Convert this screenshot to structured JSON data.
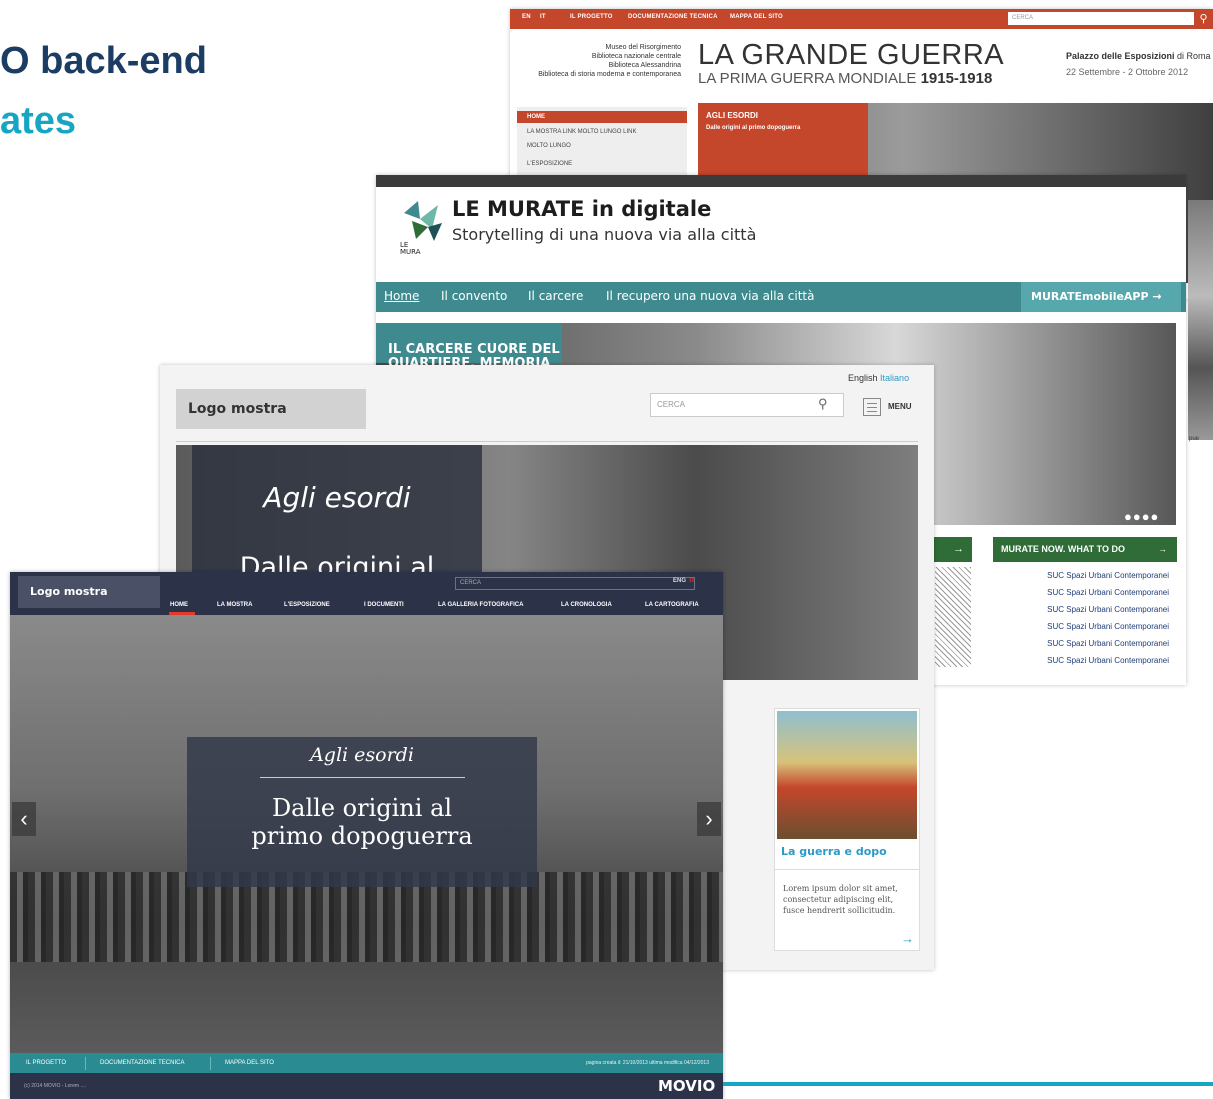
{
  "slide": {
    "title_line1": "O back-end",
    "title_line2": "ates"
  },
  "grande_guerra": {
    "top_links": [
      "EN",
      "IT",
      "IL PROGETTO",
      "DOCUMENTAZIONE TECNICA",
      "MAPPA DEL SITO"
    ],
    "search_placeholder": "CERCA",
    "institutions": [
      "Museo del Risorgimento",
      "Biblioteca nazionale centrale",
      "Biblioteca Alessandrina",
      "Biblioteca di storia moderna e contemporanea"
    ],
    "title": "LA GRANDE GUERRA",
    "subtitle_pre": "LA PRIMA GUERRA MONDIALE ",
    "subtitle_years": "1915-1918",
    "venue_name": "Palazzo delle Esposizioni",
    "venue_city": "di Roma",
    "dates": "22 Settembre - 2 Ottobre 2012",
    "nav": [
      "HOME",
      "LA MOSTRA LINK MOLTO LUNGO LINK",
      "MOLTO LUNGO",
      "L'ESPOSIZIONE"
    ],
    "hero_title": "AGLI ESORDI",
    "hero_sub": "Dalle origini al primo dopoguerra"
  },
  "murate": {
    "title": "LE MURATE in digitale",
    "subtitle": "Storytelling di una nuova via alla città",
    "logo_text": "LE MURA TE",
    "nav": [
      "Home",
      "Il convento",
      "Il carcere",
      "Il recupero una nuova via alla città"
    ],
    "app_button": "MURATEmobileAPP →",
    "hero_text": "IL CARCERE CUORE DEL QUARTIERE, MEMORIA",
    "now_header": "MURATE NOW. WHAT TO DO",
    "now_arrow": "→",
    "left_arrow": "→",
    "list": [
      "SUC Spazi Urbani Contemporanei",
      "SUC Spazi Urbani Contemporanei",
      "SUC Spazi Urbani Contemporanei",
      "SUC Spazi Urbani Contemporanei",
      "SUC Spazi Urbani Contemporanei",
      "SUC Spazi Urbani Contemporanei"
    ],
    "dots": "●●●●",
    "edge_text": "pue"
  },
  "desktop_template": {
    "logo": "Logo mostra",
    "lang_en": "English",
    "lang_it": "Italiano",
    "search_placeholder": "CERCA",
    "menu": "MENU",
    "hero_title": "Agli esordi",
    "hero_sub": "Dalle origini al",
    "card_title": "La guerra e dopo",
    "card_text": "Lorem ipsum dolor sit amet, consectetur adipiscing elit, fusce hendrerit sollicitudin.",
    "card_arrow": "→"
  },
  "front_template": {
    "logo": "Logo mostra",
    "search_placeholder": "CERCA",
    "lang_en": "ENG",
    "lang_it": "IT",
    "nav": [
      "HOME",
      "LA MOSTRA",
      "L'ESPOSIZIONE",
      "I DOCUMENTI",
      "LA GALLERIA FOTOGRAFICA",
      "LA CRONOLOGIA",
      "LA CARTOGRAFIA"
    ],
    "hero_title": "Agli esordi",
    "hero_line1": "Dalle origini al",
    "hero_line2": "primo dopoguerra",
    "arrow_left": "‹",
    "arrow_right": "›",
    "footer_links": [
      "IL PROGETTO",
      "DOCUMENTAZIONE TECNICA",
      "MAPPA DEL SITO"
    ],
    "footer_dates": "pagina creata il: 21/10/2013 ultima modifica 04/12/2013",
    "copyright": "(c) 2014 MOVIO - Lorem ....",
    "brand": "MOVIO"
  },
  "colors": {
    "title_dark": "#1c3d63",
    "title_teal": "#16a6c4",
    "gg_red": "#c4462b",
    "murate_teal": "#3f8a8f",
    "murate_green": "#2f6c37",
    "front_navy": "#2c3247",
    "accent_red": "#e23b2a"
  }
}
